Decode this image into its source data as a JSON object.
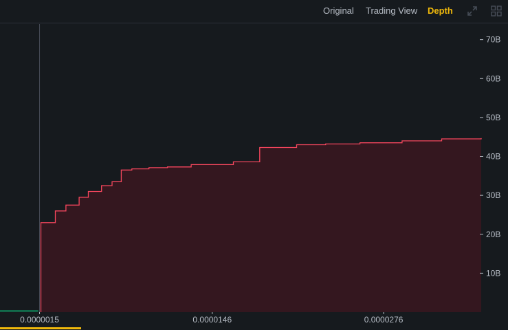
{
  "toolbar": {
    "tabs": [
      {
        "label": "Original",
        "active": false
      },
      {
        "label": "Trading View",
        "active": false
      },
      {
        "label": "Depth",
        "active": true
      }
    ],
    "icons": [
      "expand-icon",
      "grid-layout-icon"
    ]
  },
  "colors": {
    "background": "#161a1e",
    "active_tab": "#f0b90b",
    "tab_text": "#b7bdc6",
    "bid_line": "#0ecb81",
    "ask_line": "#f6465d",
    "ask_fill": "#34171f",
    "axis_text": "#b7bdc6",
    "mid_line": "#474d57"
  },
  "chart_data": {
    "type": "area",
    "title": "",
    "xlabel": "",
    "ylabel": "",
    "ylim": [
      0,
      74
    ],
    "y_unit": "B",
    "y_ticks": [
      10,
      20,
      30,
      40,
      50,
      60,
      70
    ],
    "y_tick_labels": [
      "10B",
      "20B",
      "30B",
      "40B",
      "50B",
      "60B",
      "70B"
    ],
    "x_ticks": [
      1.5e-06,
      1.46e-05,
      2.76e-05
    ],
    "x_tick_labels": [
      "0.0000015",
      "0.0000146",
      "0.0000276"
    ],
    "xlim": [
      -1.5e-06,
      3.5e-05
    ],
    "mid_price": 1.5e-06,
    "grid": false,
    "series": [
      {
        "side": "bid",
        "x": [
          -1.5e-06,
          1.4e-06
        ],
        "y": [
          0.3,
          0.3
        ]
      },
      {
        "side": "ask",
        "x": [
          1.6e-06,
          1.6e-06,
          1.7e-06,
          2.7e-06,
          3.5e-06,
          4.5e-06,
          5.2e-06,
          6.2e-06,
          7e-06,
          7.7e-06,
          8.5e-06,
          9.8e-06,
          1.12e-05,
          1.3e-05,
          1.62e-05,
          1.82e-05,
          2.1e-05,
          2.32e-05,
          2.58e-05,
          2.9e-05,
          3.2e-05,
          3.5e-05
        ],
        "y": [
          0,
          23.0,
          23.0,
          26.0,
          27.5,
          29.5,
          31.0,
          32.5,
          33.5,
          36.5,
          36.8,
          37.1,
          37.3,
          37.9,
          38.6,
          42.3,
          43.0,
          43.2,
          43.5,
          44.0,
          44.5,
          44.7
        ]
      }
    ]
  }
}
